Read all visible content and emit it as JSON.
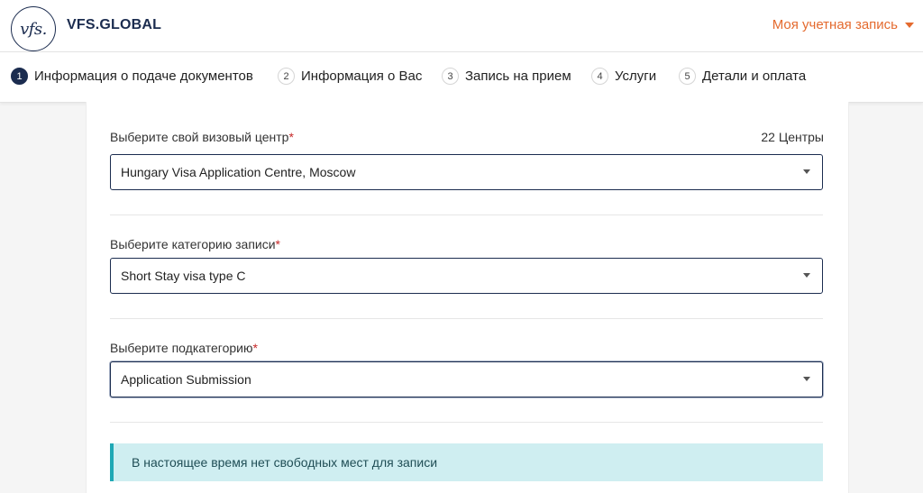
{
  "header": {
    "logo_mark": "vfs.",
    "logo_text": "VFS.GLOBAL",
    "account_label": "Моя учетная запись"
  },
  "steps": [
    {
      "num": "1",
      "label": "Информация о подаче документов",
      "active": true
    },
    {
      "num": "2",
      "label": "Информация о Вас",
      "active": false
    },
    {
      "num": "3",
      "label": "Запись на прием",
      "active": false
    },
    {
      "num": "4",
      "label": "Услуги",
      "active": false
    },
    {
      "num": "5",
      "label": "Детали и оплата",
      "active": false
    }
  ],
  "form": {
    "center": {
      "label": "Выберите свой визовый центр",
      "required_mark": "*",
      "count": "22 Центры",
      "value": "Hungary Visa Application Centre, Moscow"
    },
    "category": {
      "label": "Выберите категорию записи",
      "required_mark": "*",
      "value": "Short Stay visa type C"
    },
    "subcategory": {
      "label": "Выберите подкатегорию",
      "required_mark": "*",
      "value": "Application Submission"
    }
  },
  "alert": {
    "message": "В настоящее время нет свободных мест для записи"
  },
  "colors": {
    "brand_navy": "#1b2c4f",
    "accent_orange": "#e46a2e",
    "alert_bg": "#cfeef1",
    "alert_border": "#1fa8b5",
    "required_red": "#c62828"
  }
}
